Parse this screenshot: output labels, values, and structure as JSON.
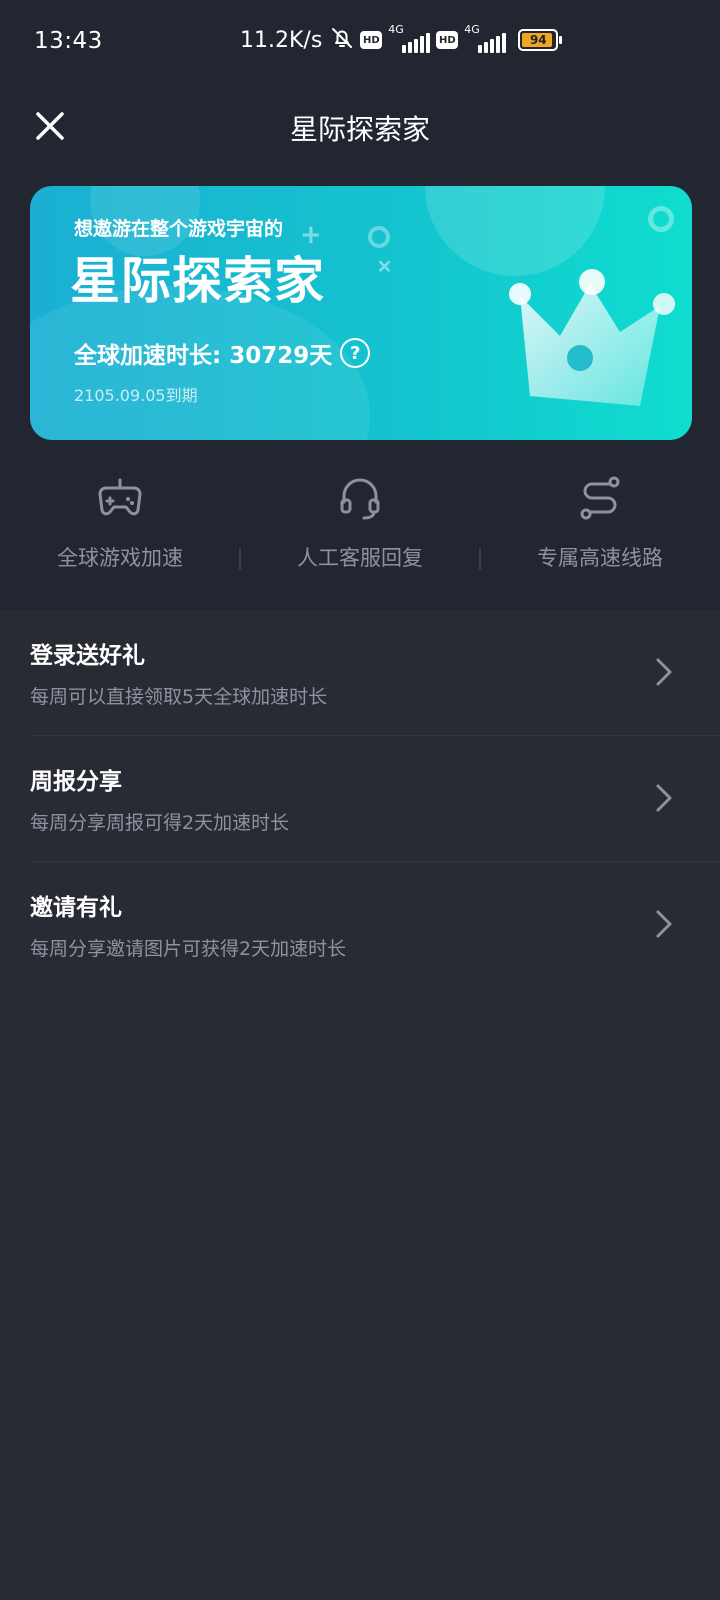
{
  "status_bar": {
    "time": "13:43",
    "net_speed": "11.2K/s",
    "hd1": "HD",
    "net1": "4G",
    "hd2": "HD",
    "net2": "4G",
    "battery": "94",
    "battery_color": "#F0A623"
  },
  "header": {
    "title": "星际探索家",
    "close_icon": "close-icon"
  },
  "banner": {
    "subtitle": "想遨游在整个游戏宇宙的",
    "title": "星际探索家",
    "duration": "全球加速时长: 30729天",
    "help_symbol": "?",
    "expire": "2105.09.05到期",
    "gradient_start": "#1BAFD3",
    "gradient_end": "#10DDCF"
  },
  "features": [
    {
      "label": "全球游戏加速",
      "icon": "gamepad-icon"
    },
    {
      "label": "人工客服回复",
      "icon": "headset-icon"
    },
    {
      "label": "专属高速线路",
      "icon": "route-icon"
    }
  ],
  "list": [
    {
      "title": "登录送好礼",
      "desc": "每周可以直接领取5天全球加速时长"
    },
    {
      "title": "周报分享",
      "desc": "每周分享周报可得2天加速时长"
    },
    {
      "title": "邀请有礼",
      "desc": "每周分享邀请图片可获得2天加速时长"
    }
  ]
}
